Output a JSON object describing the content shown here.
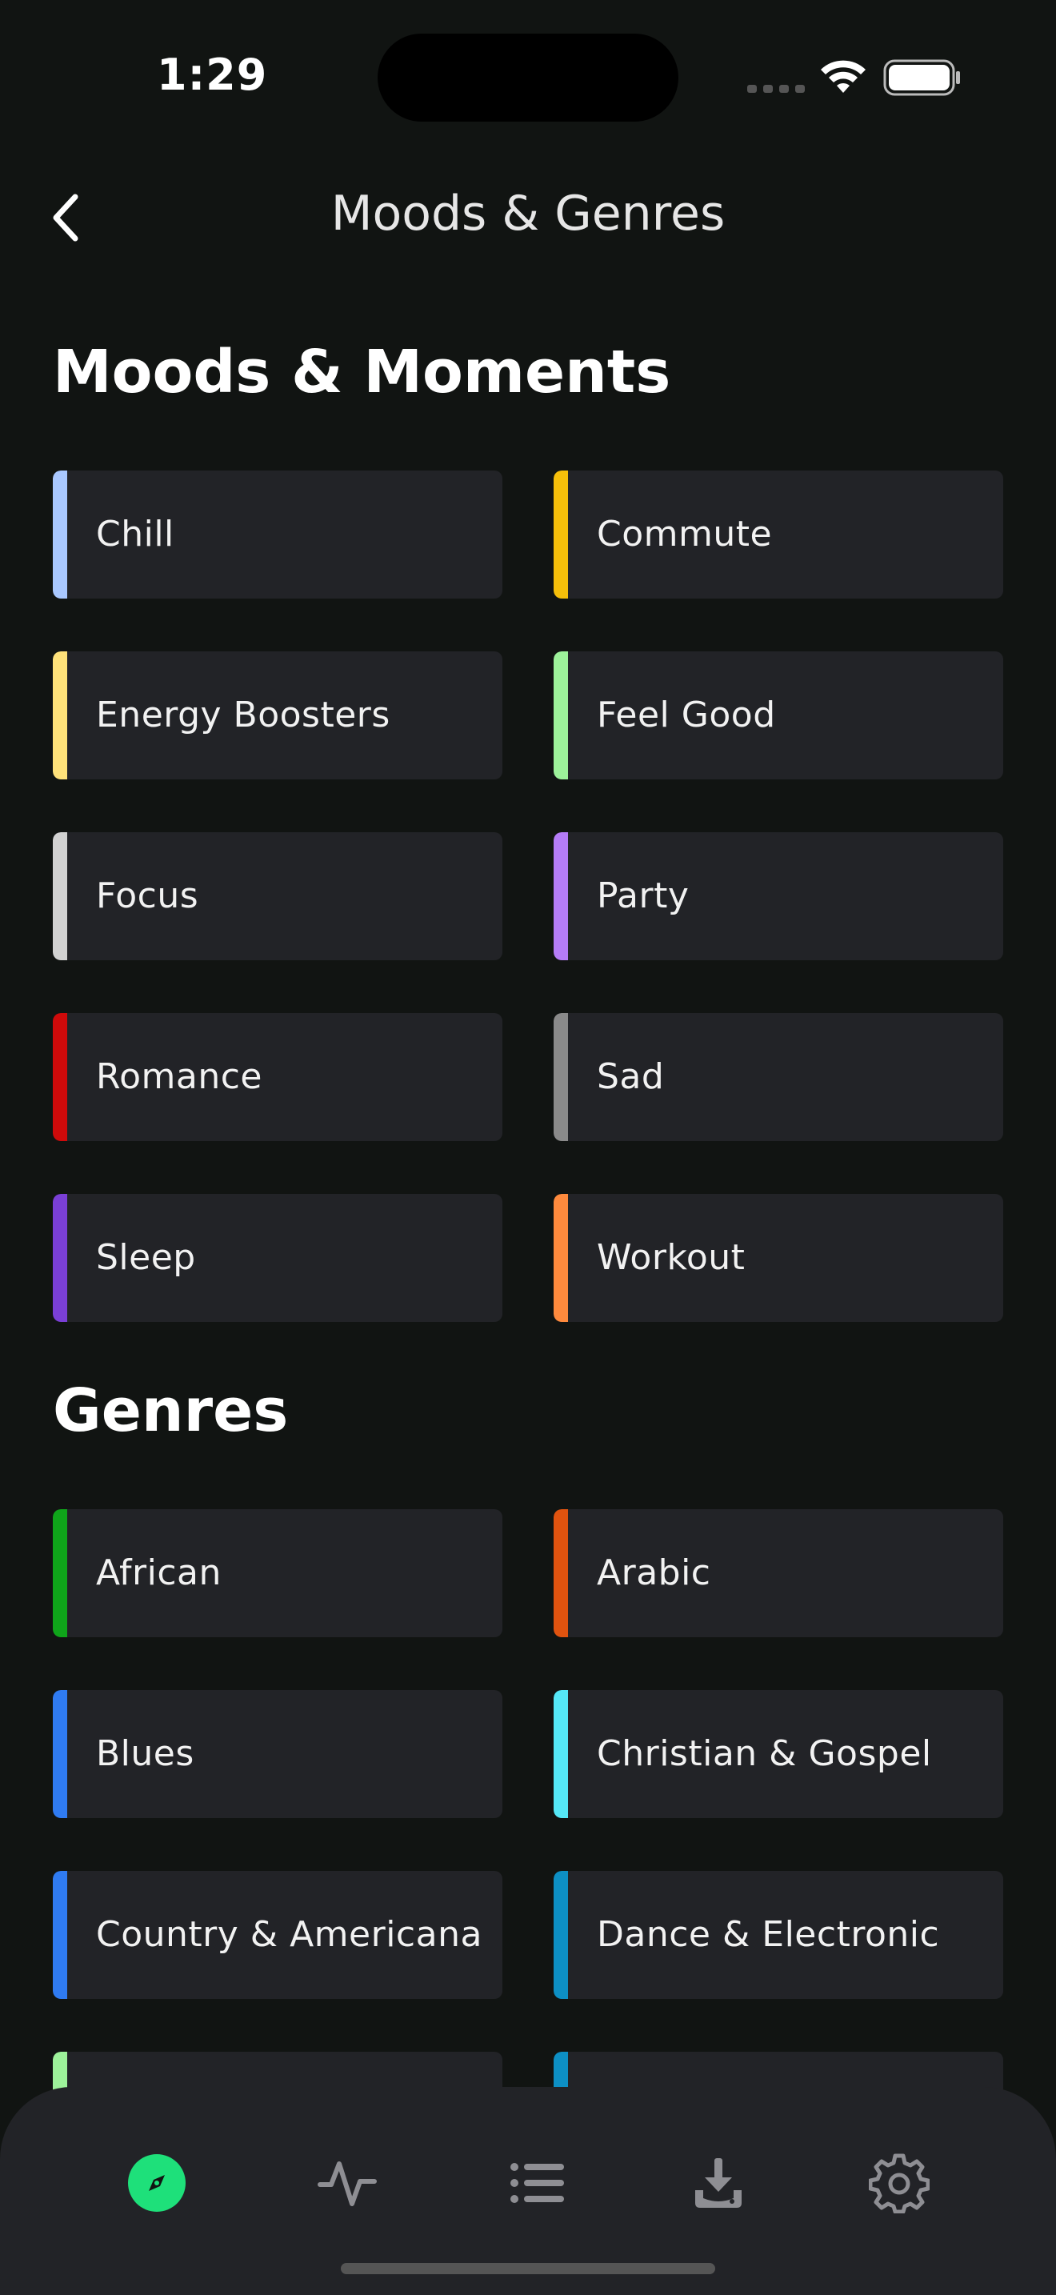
{
  "status_bar": {
    "time": "1:29"
  },
  "header": {
    "title": "Moods & Genres",
    "back_icon": "chevron-left-icon"
  },
  "moods_section": {
    "heading": "Moods & Moments",
    "items": [
      {
        "label": "Chill",
        "color": "#a9c8ff"
      },
      {
        "label": "Commute",
        "color": "#f6bf0a"
      },
      {
        "label": "Energy Boosters",
        "color": "#ffe27a"
      },
      {
        "label": "Feel Good",
        "color": "#9df29a"
      },
      {
        "label": "Focus",
        "color": "#d2d2d2"
      },
      {
        "label": "Party",
        "color": "#b57cf7"
      },
      {
        "label": "Romance",
        "color": "#cf0a0a"
      },
      {
        "label": "Sad",
        "color": "#8a8a8a"
      },
      {
        "label": "Sleep",
        "color": "#7a3fd6"
      },
      {
        "label": "Workout",
        "color": "#ff8a3d"
      }
    ]
  },
  "genres_section": {
    "heading": "Genres",
    "items": [
      {
        "label": "African",
        "color": "#0fa51a"
      },
      {
        "label": "Arabic",
        "color": "#e0530f"
      },
      {
        "label": "Blues",
        "color": "#2f7bf2"
      },
      {
        "label": "Christian & Gospel",
        "color": "#55e8f7"
      },
      {
        "label": "Country & Americana",
        "color": "#2f7bf2"
      },
      {
        "label": "Dance & Electronic",
        "color": "#0d8fc4"
      },
      {
        "label": "",
        "color": "#9df29a"
      },
      {
        "label": "",
        "color": "#0d8fc4"
      }
    ]
  },
  "bottom_nav": {
    "accent": "#1ee07a",
    "items": [
      {
        "icon": "compass-icon",
        "active": true
      },
      {
        "icon": "activity-icon",
        "active": false
      },
      {
        "icon": "list-icon",
        "active": false
      },
      {
        "icon": "download-icon",
        "active": false
      },
      {
        "icon": "gear-icon",
        "active": false
      }
    ]
  }
}
